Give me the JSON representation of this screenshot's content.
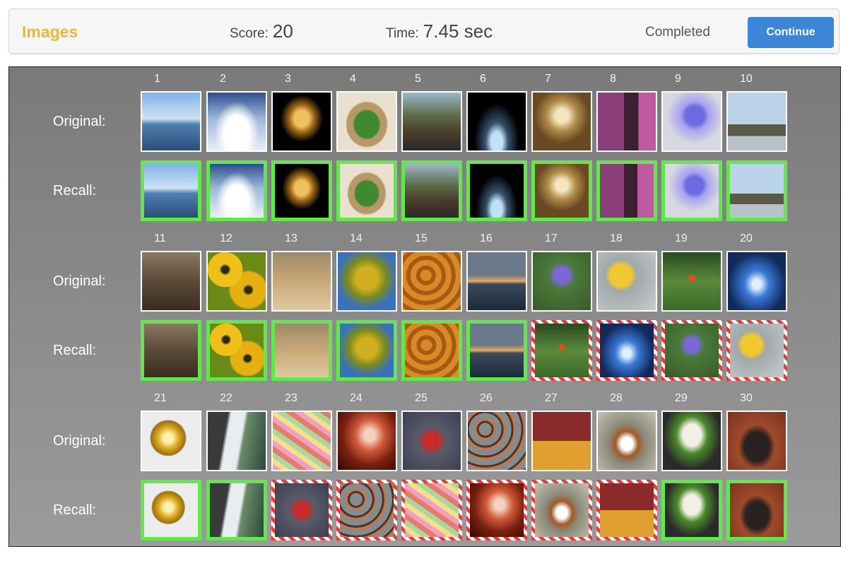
{
  "header": {
    "title": "Images",
    "score_label": "Score:",
    "score_value": "20",
    "time_label": "Time:",
    "time_value": "7.45 sec",
    "status": "Completed",
    "continue_label": "Continue"
  },
  "labels": {
    "original": "Original:",
    "recall": "Recall:"
  },
  "colors": {
    "title": "#e9b73a",
    "button": "#3b87d6",
    "correct": "#63e84c",
    "wrong": "#e83c3c"
  },
  "images": [
    "lake-fisherman",
    "clouds-aerial",
    "golden-glass",
    "green-beans-basket",
    "forest-bike-ride",
    "water-splash",
    "chandelier-hall",
    "girl-piano",
    "purple-flowers",
    "city-skyline",
    "deer-trees",
    "yellow-tulips",
    "chopping-vegetables",
    "autumn-tree",
    "cheese-puffs",
    "sea-sunset-gulls",
    "purple-crocus",
    "yellow-flower",
    "red-poppy-field",
    "blue-glass-hall",
    "golden-ball",
    "waterfall",
    "macarons",
    "red-fire-sky",
    "red-tram-street",
    "glowing-coals",
    "red-beans-corn",
    "spaniel-dog",
    "toy-lion",
    "gorilla-party-hat"
  ],
  "groups": [
    {
      "numbers": [
        "1",
        "2",
        "3",
        "4",
        "5",
        "6",
        "7",
        "8",
        "9",
        "10"
      ],
      "original": [
        0,
        1,
        2,
        3,
        4,
        5,
        6,
        7,
        8,
        9
      ],
      "recall": [
        0,
        1,
        2,
        3,
        4,
        5,
        6,
        7,
        8,
        9
      ],
      "recall_status": [
        "correct",
        "correct",
        "correct",
        "correct",
        "correct",
        "correct",
        "correct",
        "correct",
        "correct",
        "correct"
      ]
    },
    {
      "numbers": [
        "11",
        "12",
        "13",
        "14",
        "15",
        "16",
        "17",
        "18",
        "19",
        "20"
      ],
      "original": [
        10,
        11,
        12,
        13,
        14,
        15,
        16,
        17,
        18,
        19
      ],
      "recall": [
        10,
        11,
        12,
        13,
        14,
        15,
        18,
        19,
        16,
        17
      ],
      "recall_status": [
        "correct",
        "correct",
        "correct",
        "correct",
        "correct",
        "correct",
        "wrong",
        "wrong",
        "wrong",
        "wrong"
      ]
    },
    {
      "numbers": [
        "21",
        "22",
        "23",
        "24",
        "25",
        "26",
        "27",
        "28",
        "29",
        "30"
      ],
      "original": [
        20,
        21,
        22,
        23,
        24,
        25,
        26,
        27,
        28,
        29
      ],
      "recall": [
        20,
        21,
        24,
        25,
        22,
        23,
        27,
        26,
        28,
        29
      ],
      "recall_status": [
        "correct",
        "correct",
        "wrong",
        "wrong",
        "wrong",
        "wrong",
        "wrong",
        "wrong",
        "correct",
        "correct"
      ]
    }
  ]
}
